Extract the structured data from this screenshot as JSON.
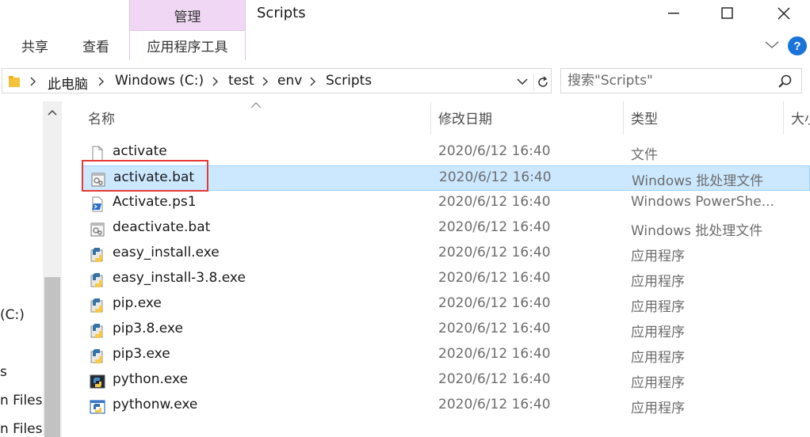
{
  "window": {
    "title": "Scripts",
    "context_tab_group": "管理"
  },
  "ribbon": {
    "tabs": [
      {
        "label": "共享"
      },
      {
        "label": "查看"
      },
      {
        "label": "应用程序工具"
      }
    ]
  },
  "address": {
    "crumbs": [
      "此电脑",
      "Windows (C:)",
      "test",
      "env",
      "Scripts"
    ]
  },
  "search": {
    "placeholder": "搜索\"Scripts\""
  },
  "nav": {
    "items": [
      "(C:)",
      "s",
      "n Files",
      "n Files"
    ]
  },
  "columns": {
    "name": "名称",
    "date": "修改日期",
    "type": "类型",
    "size": "大小"
  },
  "files": [
    {
      "name": "activate",
      "date": "2020/6/12 16:40",
      "type": "文件",
      "icon": "generic-file-icon"
    },
    {
      "name": "activate.bat",
      "date": "2020/6/12 16:40",
      "type": "Windows 批处理文件",
      "icon": "batch-file-icon",
      "selected": true
    },
    {
      "name": "Activate.ps1",
      "date": "2020/6/12 16:40",
      "type": "Windows PowerShe...",
      "icon": "powershell-file-icon"
    },
    {
      "name": "deactivate.bat",
      "date": "2020/6/12 16:40",
      "type": "Windows 批处理文件",
      "icon": "batch-file-icon"
    },
    {
      "name": "easy_install.exe",
      "date": "2020/6/12 16:40",
      "type": "应用程序",
      "icon": "python-exe-icon"
    },
    {
      "name": "easy_install-3.8.exe",
      "date": "2020/6/12 16:40",
      "type": "应用程序",
      "icon": "python-exe-icon"
    },
    {
      "name": "pip.exe",
      "date": "2020/6/12 16:40",
      "type": "应用程序",
      "icon": "python-exe-icon"
    },
    {
      "name": "pip3.8.exe",
      "date": "2020/6/12 16:40",
      "type": "应用程序",
      "icon": "python-exe-icon"
    },
    {
      "name": "pip3.exe",
      "date": "2020/6/12 16:40",
      "type": "应用程序",
      "icon": "python-exe-icon"
    },
    {
      "name": "python.exe",
      "date": "2020/6/12 16:40",
      "type": "应用程序",
      "icon": "python-console-icon"
    },
    {
      "name": "pythonw.exe",
      "date": "2020/6/12 16:40",
      "type": "应用程序",
      "icon": "python-window-icon"
    }
  ],
  "colors": {
    "selection_bg": "#cce8ff",
    "selection_border": "#99d1ff",
    "context_tab": "#f0d8f4",
    "help_blue": "#1a73d9",
    "highlight_red": "#e53935"
  }
}
